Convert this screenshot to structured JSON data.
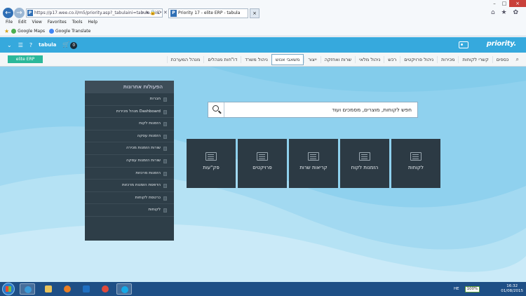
{
  "browser": {
    "url": "https://p17.wee.co.il/m5/priority.asp?_tabulaini=tabula.ini&",
    "tabs": [
      {
        "label": "Priority 17 - elite ERP - tabula"
      },
      {
        "label": "×"
      }
    ],
    "menu": [
      "File",
      "Edit",
      "View",
      "Favorites",
      "Tools",
      "Help"
    ],
    "favorites": [
      {
        "label": "Google Maps",
        "color": "#4caf50"
      },
      {
        "label": "Google Translate",
        "color": "#4285f4"
      }
    ],
    "window_controls": {
      "minimize": "–",
      "maximize": "□",
      "close": "×"
    },
    "toolbar_icons": "⌂ ★ ✿"
  },
  "app": {
    "logo": "priority.",
    "company": "tabula",
    "cart_count": "0",
    "entity_badge": "elite ERP",
    "menu": [
      {
        "label": "כספים"
      },
      {
        "label": "קשרי לקוחות"
      },
      {
        "label": "מכירות"
      },
      {
        "label": "ניהול פרויקטים"
      },
      {
        "label": "רכש"
      },
      {
        "label": "ניהול מלאי"
      },
      {
        "label": "שרות ואחזקה"
      },
      {
        "label": "ייצור"
      },
      {
        "label": "משאבי אנוש",
        "active": true
      },
      {
        "label": "ניהול משרד"
      },
      {
        "label": "דו\"חות מנהלים"
      },
      {
        "label": "מנהל המערכת"
      }
    ],
    "search_placeholder": "חפש לקוחות, מוצרים, מסמכים ועוד",
    "recent": {
      "title": "הפעולות אחרונות",
      "items": [
        "חברות",
        "מנהל מכירות Dashboard",
        "הזמנות לקוח",
        "הזמנות עסקה",
        "שורות הזמנות מכירה",
        "שורות הזמנות עסקה",
        "הזמנות מרכזות",
        "הדפסת הזמנות מרכזות",
        "כרטסת לקוחות",
        "לקוחות"
      ]
    },
    "tiles": [
      {
        "label": "לקוחות"
      },
      {
        "label": "הזמנות לקוח"
      },
      {
        "label": "קריאות שרות"
      },
      {
        "label": "פרויקטים"
      },
      {
        "label": "פק\"עות"
      }
    ]
  },
  "taskbar": {
    "language": "HE",
    "battery": "100%",
    "time": "16:32",
    "date": "01/08/2015",
    "apps": [
      {
        "name": "ie",
        "color": "#3a9ad9",
        "active": true
      },
      {
        "name": "explorer",
        "color": "#e9c25a"
      },
      {
        "name": "media",
        "color": "#e87e24"
      },
      {
        "name": "outlook",
        "color": "#1f6fc1"
      },
      {
        "name": "chrome",
        "color": "#e04a3b"
      },
      {
        "name": "skype",
        "color": "#17a9e6",
        "active": true
      }
    ]
  }
}
